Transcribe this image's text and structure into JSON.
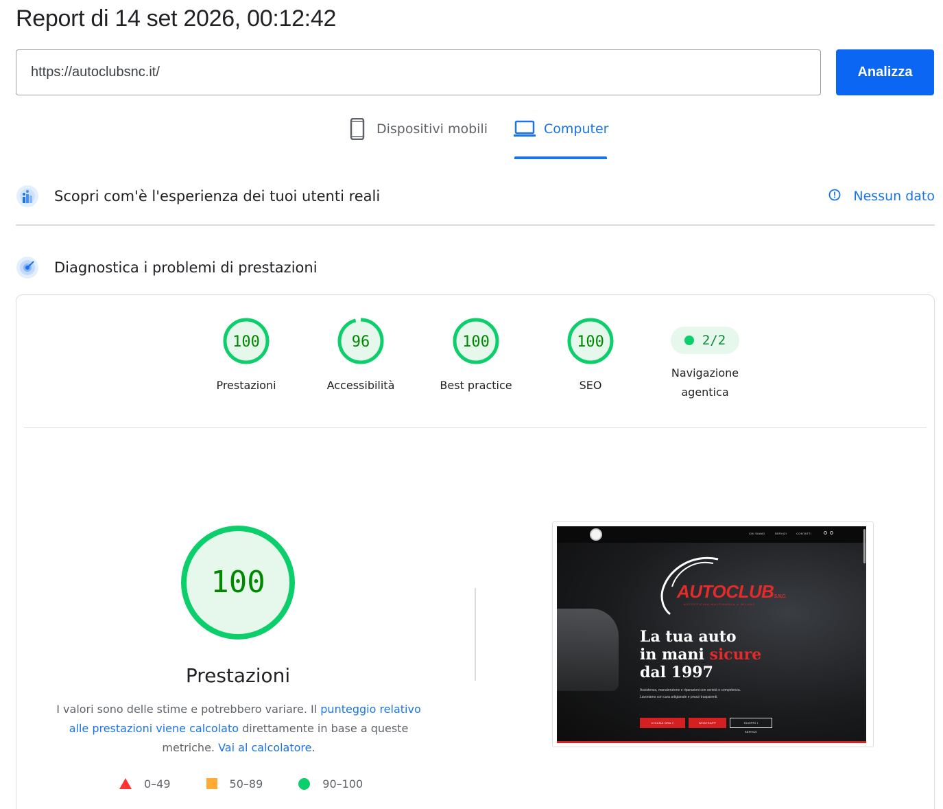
{
  "header": {
    "title": "Report di 14 set 2026, 00:12:42"
  },
  "url_input": {
    "value": "https://autoclubsnc.it/"
  },
  "analyze_button": {
    "label": "Analizza"
  },
  "tabs": [
    {
      "label": "Dispositivi mobili",
      "icon": "smartphone-icon",
      "selected": false
    },
    {
      "label": "Computer",
      "icon": "laptop-icon",
      "selected": true
    }
  ],
  "crux_section": {
    "title": "Scopri com'è l'esperienza dei tuoi utenti reali",
    "status_label": "Nessun dato",
    "status_icon": "info-icon"
  },
  "diagnostics_section": {
    "title": "Diagnostica i problemi di prestazioni"
  },
  "categories": [
    {
      "score": "100",
      "label": "Prestazioni",
      "fraction": 1.0
    },
    {
      "score": "96",
      "label": "Accessibilità",
      "fraction": 0.96
    },
    {
      "score": "100",
      "label": "Best practice",
      "fraction": 1.0
    },
    {
      "score": "100",
      "label": "SEO",
      "fraction": 1.0
    }
  ],
  "agentic": {
    "value": "2/2",
    "label_line1": "Navigazione",
    "label_line2": "agentica"
  },
  "performance": {
    "score": "100",
    "title": "Prestazioni",
    "desc_text1": "I valori sono delle stime e potrebbero variare. Il ",
    "desc_link1": "punteggio relativo alle prestazioni viene calcolato",
    "desc_text2": " direttamente in base a queste metriche. ",
    "desc_link2": "Vai al calcolatore",
    "desc_text3": "."
  },
  "legend": [
    {
      "range": "0–49",
      "shape": "triangle",
      "color": "#ff3333"
    },
    {
      "range": "50–89",
      "shape": "square",
      "color": "#ffaa33"
    },
    {
      "range": "90–100",
      "shape": "circle",
      "color": "#0cce6b"
    }
  ],
  "screenshot": {
    "nav_items": [
      "CHI SIAMO",
      "SERVIZI",
      "CONTATTI"
    ],
    "brand": "AUTOCLUB",
    "brand_suffix": "S.N.C.",
    "tagline": "AUTOFFICINA MULTIMARCA A MILANO",
    "headline_line1": "La tua auto",
    "headline_line2_a": "in mani ",
    "headline_line2_b": "sicure",
    "headline_line3": "dal 1997",
    "body": "Assistenza, manutenzione e riparazioni con serietà e competenza. Lavoriamo con cura artigianale e prezzi trasparenti.",
    "buttons": [
      "CHIAMA ORA ▾",
      "WHATSAPP",
      "SCOPRI I SERVIZI"
    ]
  },
  "colors": {
    "accent": "#1a73e8",
    "button": "#0b66f4",
    "pass": "#0cce6b",
    "pass_text": "#008800",
    "average": "#ffaa33",
    "fail": "#ff3333"
  }
}
